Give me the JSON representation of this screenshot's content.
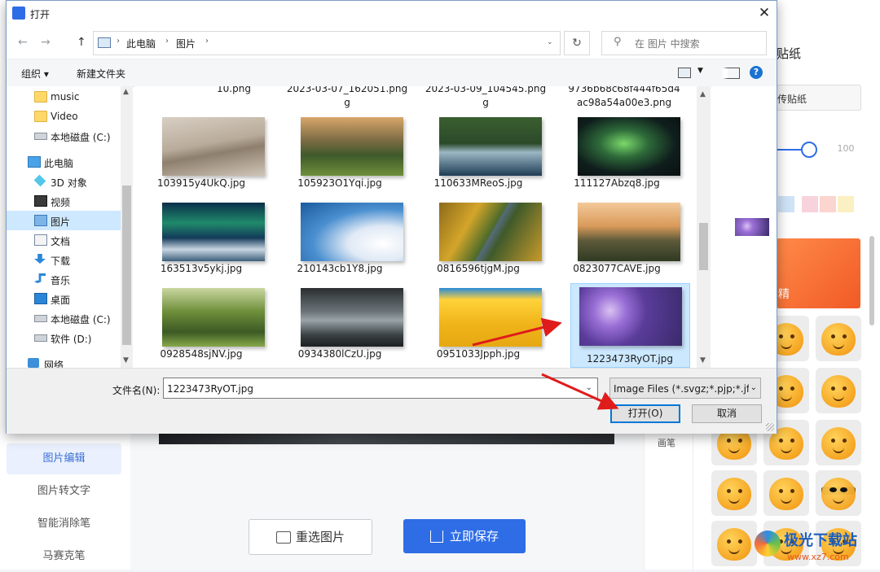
{
  "dialog": {
    "title": "打开",
    "close": "✕",
    "back": "←",
    "forward": "→",
    "up": "↑",
    "breadcrumb": [
      "此电脑",
      "图片"
    ],
    "refresh": "↻",
    "search_placeholder": "在 图片 中搜索",
    "organize": "组织 ▾",
    "new_folder": "新建文件夹",
    "help": "?",
    "tree": [
      {
        "label": "music",
        "icon": "folder-icon"
      },
      {
        "label": "Video",
        "icon": "folder-icon"
      },
      {
        "label": "本地磁盘 (C:)",
        "icon": "drive-icon"
      },
      {
        "label": "此电脑",
        "icon": "pc-icon"
      },
      {
        "label": "3D 对象",
        "icon": "cube-icon"
      },
      {
        "label": "视频",
        "icon": "video-icon"
      },
      {
        "label": "图片",
        "icon": "pictures-icon",
        "selected": true
      },
      {
        "label": "文档",
        "icon": "document-icon"
      },
      {
        "label": "下载",
        "icon": "download-icon"
      },
      {
        "label": "音乐",
        "icon": "music-icon"
      },
      {
        "label": "桌面",
        "icon": "desktop-icon"
      },
      {
        "label": "本地磁盘 (C:)",
        "icon": "drive-icon"
      },
      {
        "label": "软件 (D:)",
        "icon": "drive-icon"
      },
      {
        "label": "网络",
        "icon": "network-icon"
      }
    ],
    "partial_top": [
      "10.png",
      "2023-03-07_162051.png\ng",
      "2023-03-09_104545.png\ng",
      "9736b68c68f444f65d4\nac98a54a00e3.png"
    ],
    "files": [
      {
        "name": "103915y4UkQ.jpg",
        "thumb": "desert"
      },
      {
        "name": "105923O1Yqi.jpg",
        "thumb": "meadow"
      },
      {
        "name": "110633MReoS.jpg",
        "thumb": "lake"
      },
      {
        "name": "111127Abzq8.jpg",
        "thumb": "aurora"
      },
      {
        "name": "163513v5ykj.jpg",
        "thumb": "aurora2"
      },
      {
        "name": "210143cb1Y8.jpg",
        "thumb": "clouds"
      },
      {
        "name": "0816596tjgM.jpg",
        "thumb": "road"
      },
      {
        "name": "0823077CAVE.jpg",
        "thumb": "castle"
      },
      {
        "name": "0928548sjNV.jpg",
        "thumb": "valley"
      },
      {
        "name": "0934380lCzU.jpg",
        "thumb": "river"
      },
      {
        "name": "0951033Jpph.jpg",
        "thumb": "windows"
      },
      {
        "name": "1223473RyOT.jpg",
        "thumb": "flowers",
        "selected": true
      }
    ],
    "filename_label": "文件名(N):",
    "filename_value": "1223473RyOT.jpg",
    "filetype_value": "Image Files (*.svgz;*.pjp;*.jfif",
    "open_button": "打开(O)",
    "cancel_button": "取消"
  },
  "background_app": {
    "panel_title": "贴纸",
    "upload_sticker": "传贴纸",
    "slider_value": "100",
    "expression_tab": "精",
    "tool_label": "画笔",
    "nav": [
      "图片编辑",
      "图片转文字",
      "智能消除笔",
      "马赛克笔"
    ],
    "reselect_button": "重选图片",
    "save_button": "立即保存",
    "watermark": "极光下载站",
    "watermark_url": "www.xz7.com",
    "swatch_colors": [
      "#cfe3f7",
      "#f8d3dc",
      "#fbd5cf",
      "#fbf0c3"
    ],
    "accent": "#2f6de6"
  }
}
